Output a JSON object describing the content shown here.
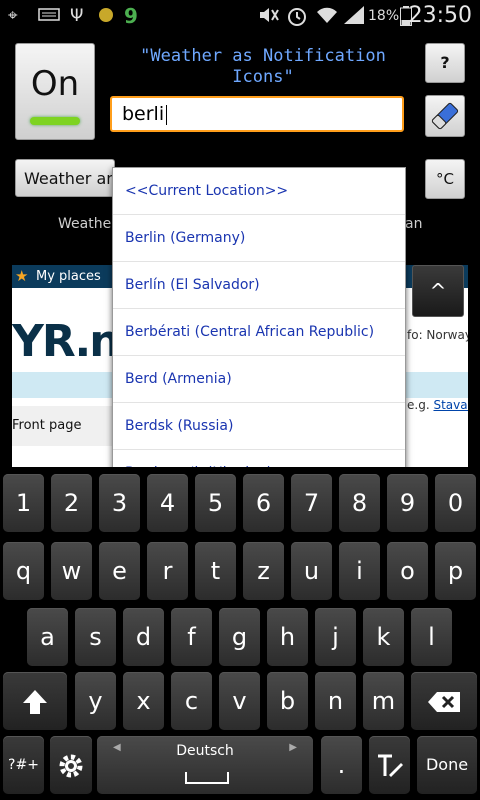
{
  "status_bar": {
    "time": "23:50",
    "battery": "18%",
    "icons": [
      "gps-icon",
      "keyboard-icon",
      "usb-icon",
      "dot-icon",
      "g-icon",
      "mute-icon",
      "alarm-icon",
      "wifi-icon",
      "signal-icon",
      "battery-icon"
    ],
    "g_glyph": "9",
    "dot_color": "#c8a82a",
    "g_color": "#4caf50"
  },
  "app": {
    "on_button": "On",
    "title": "\"Weather as Notification Icons\"",
    "help_button": "?",
    "search": {
      "value": "berli"
    },
    "weather_select": "Weather an",
    "unit_button": "°C",
    "weather_from_left": "Weathe",
    "weather_from_right": "an",
    "up_button": "^"
  },
  "webview": {
    "my_places": "My places",
    "logo": "YR.n",
    "right_text_1": "fo: Norway a",
    "right_text_2_prefix": "e.g.",
    "right_text_2_link": "Stavang",
    "front_page": "Front page"
  },
  "dropdown": {
    "items": [
      "<<Current Location>>",
      "Berlin (Germany)",
      "Berlín (El Salvador)",
      "Berbérati (Central African Republic)",
      "Berd (Armenia)",
      "Berdsk (Russia)",
      "Berdyans'k (Ukraine)"
    ]
  },
  "keyboard": {
    "row1": [
      "1",
      "2",
      "3",
      "4",
      "5",
      "6",
      "7",
      "8",
      "9",
      "0"
    ],
    "row2": [
      "q",
      "w",
      "e",
      "r",
      "t",
      "z",
      "u",
      "i",
      "o",
      "p"
    ],
    "row3": [
      "a",
      "s",
      "d",
      "f",
      "g",
      "h",
      "j",
      "k",
      "l"
    ],
    "row4": [
      "y",
      "x",
      "c",
      "v",
      "b",
      "n",
      "m"
    ],
    "symbols_key": "?#+",
    "space_label": "Deutsch",
    "period_key": ".",
    "done_key": "Done"
  },
  "colors": {
    "title_blue": "#6fa8ff",
    "input_border": "#ff9e1b",
    "link_blue": "#1a35b0",
    "on_led": "#7ed321"
  }
}
